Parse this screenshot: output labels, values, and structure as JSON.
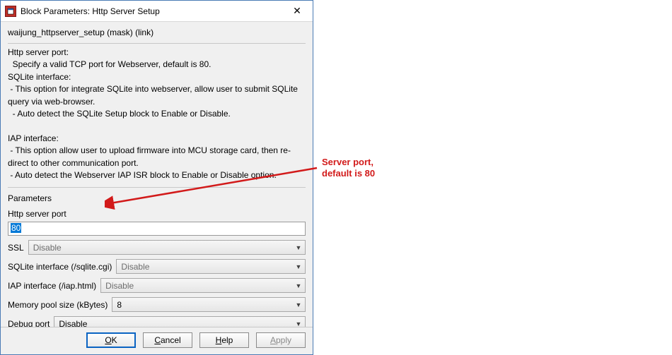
{
  "title": "Block Parameters: Http Server Setup",
  "mask_line": "waijung_httpserver_setup (mask) (link)",
  "description": "Http server port:\n  Specify a valid TCP port for Webserver, default is 80.\nSQLite interface:\n - This option for integrate SQLite into webserver, allow user to submit SQLite query via web-browser.\n  - Auto detect the SQLite Setup block to Enable or Disable.\n\nIAP interface:\n - This option allow user to upload firmware into MCU storage card, then re-direct to other communication port.\n - Auto detect the Webserver IAP ISR block to Enable or Disable option.",
  "group_label": "Parameters",
  "params": {
    "http_port": {
      "label": "Http server port",
      "value": "80"
    },
    "ssl": {
      "label": "SSL",
      "value": "Disable",
      "enabled": false
    },
    "sqlite": {
      "label": "SQLite interface (/sqlite.cgi)",
      "value": "Disable",
      "enabled": false
    },
    "iap": {
      "label": "IAP interface (/iap.html)",
      "value": "Disable",
      "enabled": false
    },
    "mempool": {
      "label": "Memory pool size (kBytes)",
      "value": "8",
      "enabled": true
    },
    "debugport": {
      "label": "Debug port",
      "value": "Disable",
      "enabled": true
    }
  },
  "buttons": {
    "ok": "OK",
    "cancel": "Cancel",
    "help": "Help",
    "apply": "Apply"
  },
  "annotation": "Server port,\ndefault is 80"
}
